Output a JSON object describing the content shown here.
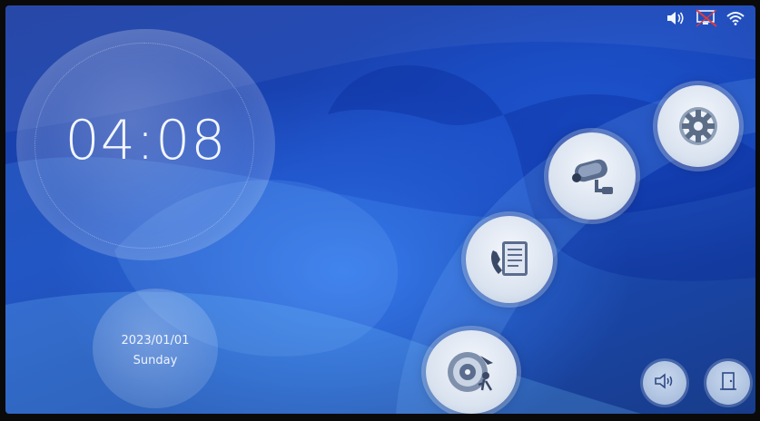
{
  "status_bar": {
    "volume_icon": "speaker-volume-icon",
    "monitor_icon": "monitor-disconnected-icon",
    "wifi_icon": "wifi-icon",
    "monitor_color": "#e23b3b"
  },
  "clock": {
    "time": "04:08"
  },
  "date": {
    "date": "2023/01/01",
    "weekday": "Sunday"
  },
  "menu": {
    "settings_icon": "gear-icon",
    "monitor_icon": "security-camera-icon",
    "call_log_icon": "phone-record-icon",
    "playback_icon": "playback-icon"
  },
  "bottom_controls": {
    "volume_icon": "speaker-icon",
    "door_icon": "door-icon"
  },
  "colors": {
    "background": "#1744b8",
    "bubble": "#d9e2ef",
    "icon": "#3a4a66"
  }
}
